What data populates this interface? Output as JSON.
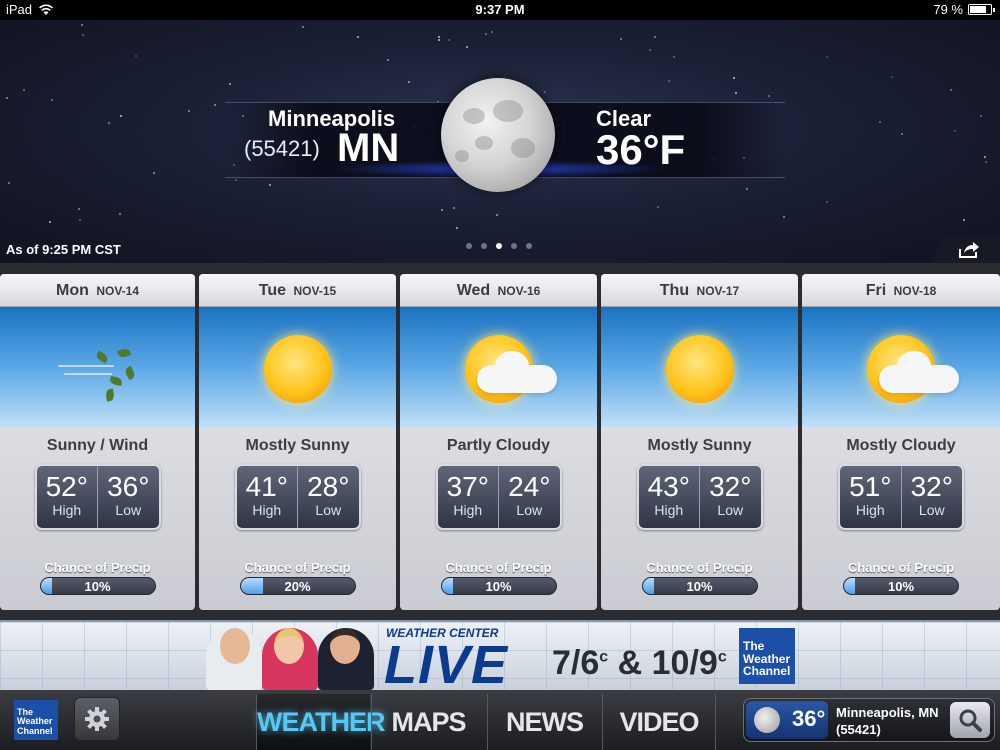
{
  "status_bar": {
    "device": "iPad",
    "time": "9:37 PM",
    "battery": "79 %",
    "battery_level": 0.79
  },
  "current": {
    "city": "Minneapolis",
    "zip": "(55421)",
    "state": "MN",
    "condition": "Clear",
    "temperature": "36°F",
    "icon": "moon-icon",
    "as_of": "As of 9:25 PM CST"
  },
  "page_dots": {
    "count": 5,
    "active": 2
  },
  "forecast": [
    {
      "day": "Mon",
      "date": "NOV-14",
      "condition": "Sunny / Wind",
      "icon": "wind-icon",
      "high": "52°",
      "low": "36°",
      "high_label": "High",
      "low_label": "Low",
      "precip_label": "Chance of Precip",
      "precip": "10%",
      "precip_value": 0.1
    },
    {
      "day": "Tue",
      "date": "NOV-15",
      "condition": "Mostly Sunny",
      "icon": "sun-icon",
      "high": "41°",
      "low": "28°",
      "high_label": "High",
      "low_label": "Low",
      "precip_label": "Chance of Precip",
      "precip": "20%",
      "precip_value": 0.2
    },
    {
      "day": "Wed",
      "date": "NOV-16",
      "condition": "Partly Cloudy",
      "icon": "partly-cloudy-icon",
      "high": "37°",
      "low": "24°",
      "high_label": "High",
      "low_label": "Low",
      "precip_label": "Chance of Precip",
      "precip": "10%",
      "precip_value": 0.1
    },
    {
      "day": "Thu",
      "date": "NOV-17",
      "condition": "Mostly Sunny",
      "icon": "sun-icon",
      "high": "43°",
      "low": "32°",
      "high_label": "High",
      "low_label": "Low",
      "precip_label": "Chance of Precip",
      "precip": "10%",
      "precip_value": 0.1
    },
    {
      "day": "Fri",
      "date": "NOV-18",
      "condition": "Mostly Cloudy",
      "icon": "partly-cloudy-icon",
      "high": "51°",
      "low": "32°",
      "high_label": "High",
      "low_label": "Low",
      "precip_label": "Chance of Precip",
      "precip": "10%",
      "precip_value": 0.1
    }
  ],
  "ad": {
    "small_title": "WEATHER CENTER",
    "big_title": "LIVE",
    "time1": "7/6",
    "time_sup": "c",
    "amp": "&",
    "time2": "10/9",
    "logo_line1": "The",
    "logo_line2": "Weather",
    "logo_line3": "Channel"
  },
  "nav": {
    "logo_line1": "The",
    "logo_line2": "Weather",
    "logo_line3": "Channel",
    "tabs": [
      "WEATHER",
      "MAPS",
      "NEWS",
      "VIDEO"
    ],
    "active_tab": "WEATHER",
    "location_temp": "36°",
    "location_city": "Minneapolis, MN",
    "location_zip": "(55421)"
  },
  "colors": {
    "active_tab": "#56c8f2",
    "brand_blue": "#1b4fa8",
    "precip_fill": "#4f9ee8"
  }
}
